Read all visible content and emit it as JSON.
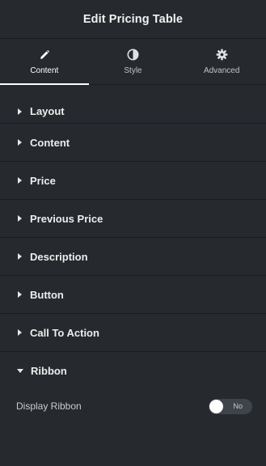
{
  "header": {
    "title": "Edit Pricing Table"
  },
  "tabs": [
    {
      "label": "Content",
      "icon": "pencil-icon",
      "active": true
    },
    {
      "label": "Style",
      "icon": "half-circle-icon",
      "active": false
    },
    {
      "label": "Advanced",
      "icon": "gear-icon",
      "active": false
    }
  ],
  "sections": [
    {
      "label": "Layout",
      "expanded": false
    },
    {
      "label": "Content",
      "expanded": false
    },
    {
      "label": "Price",
      "expanded": false
    },
    {
      "label": "Previous Price",
      "expanded": false
    },
    {
      "label": "Description",
      "expanded": false
    },
    {
      "label": "Button",
      "expanded": false
    },
    {
      "label": "Call To Action",
      "expanded": false
    },
    {
      "label": "Ribbon",
      "expanded": true
    }
  ],
  "ribbon": {
    "display_label": "Display Ribbon",
    "toggle_text": "No",
    "toggle_on": false
  },
  "colors": {
    "panel_bg": "#26292e",
    "divider": "#1a1c1f",
    "active_tab_indicator": "#ffffff",
    "toggle_off_bg": "#3f444b"
  }
}
